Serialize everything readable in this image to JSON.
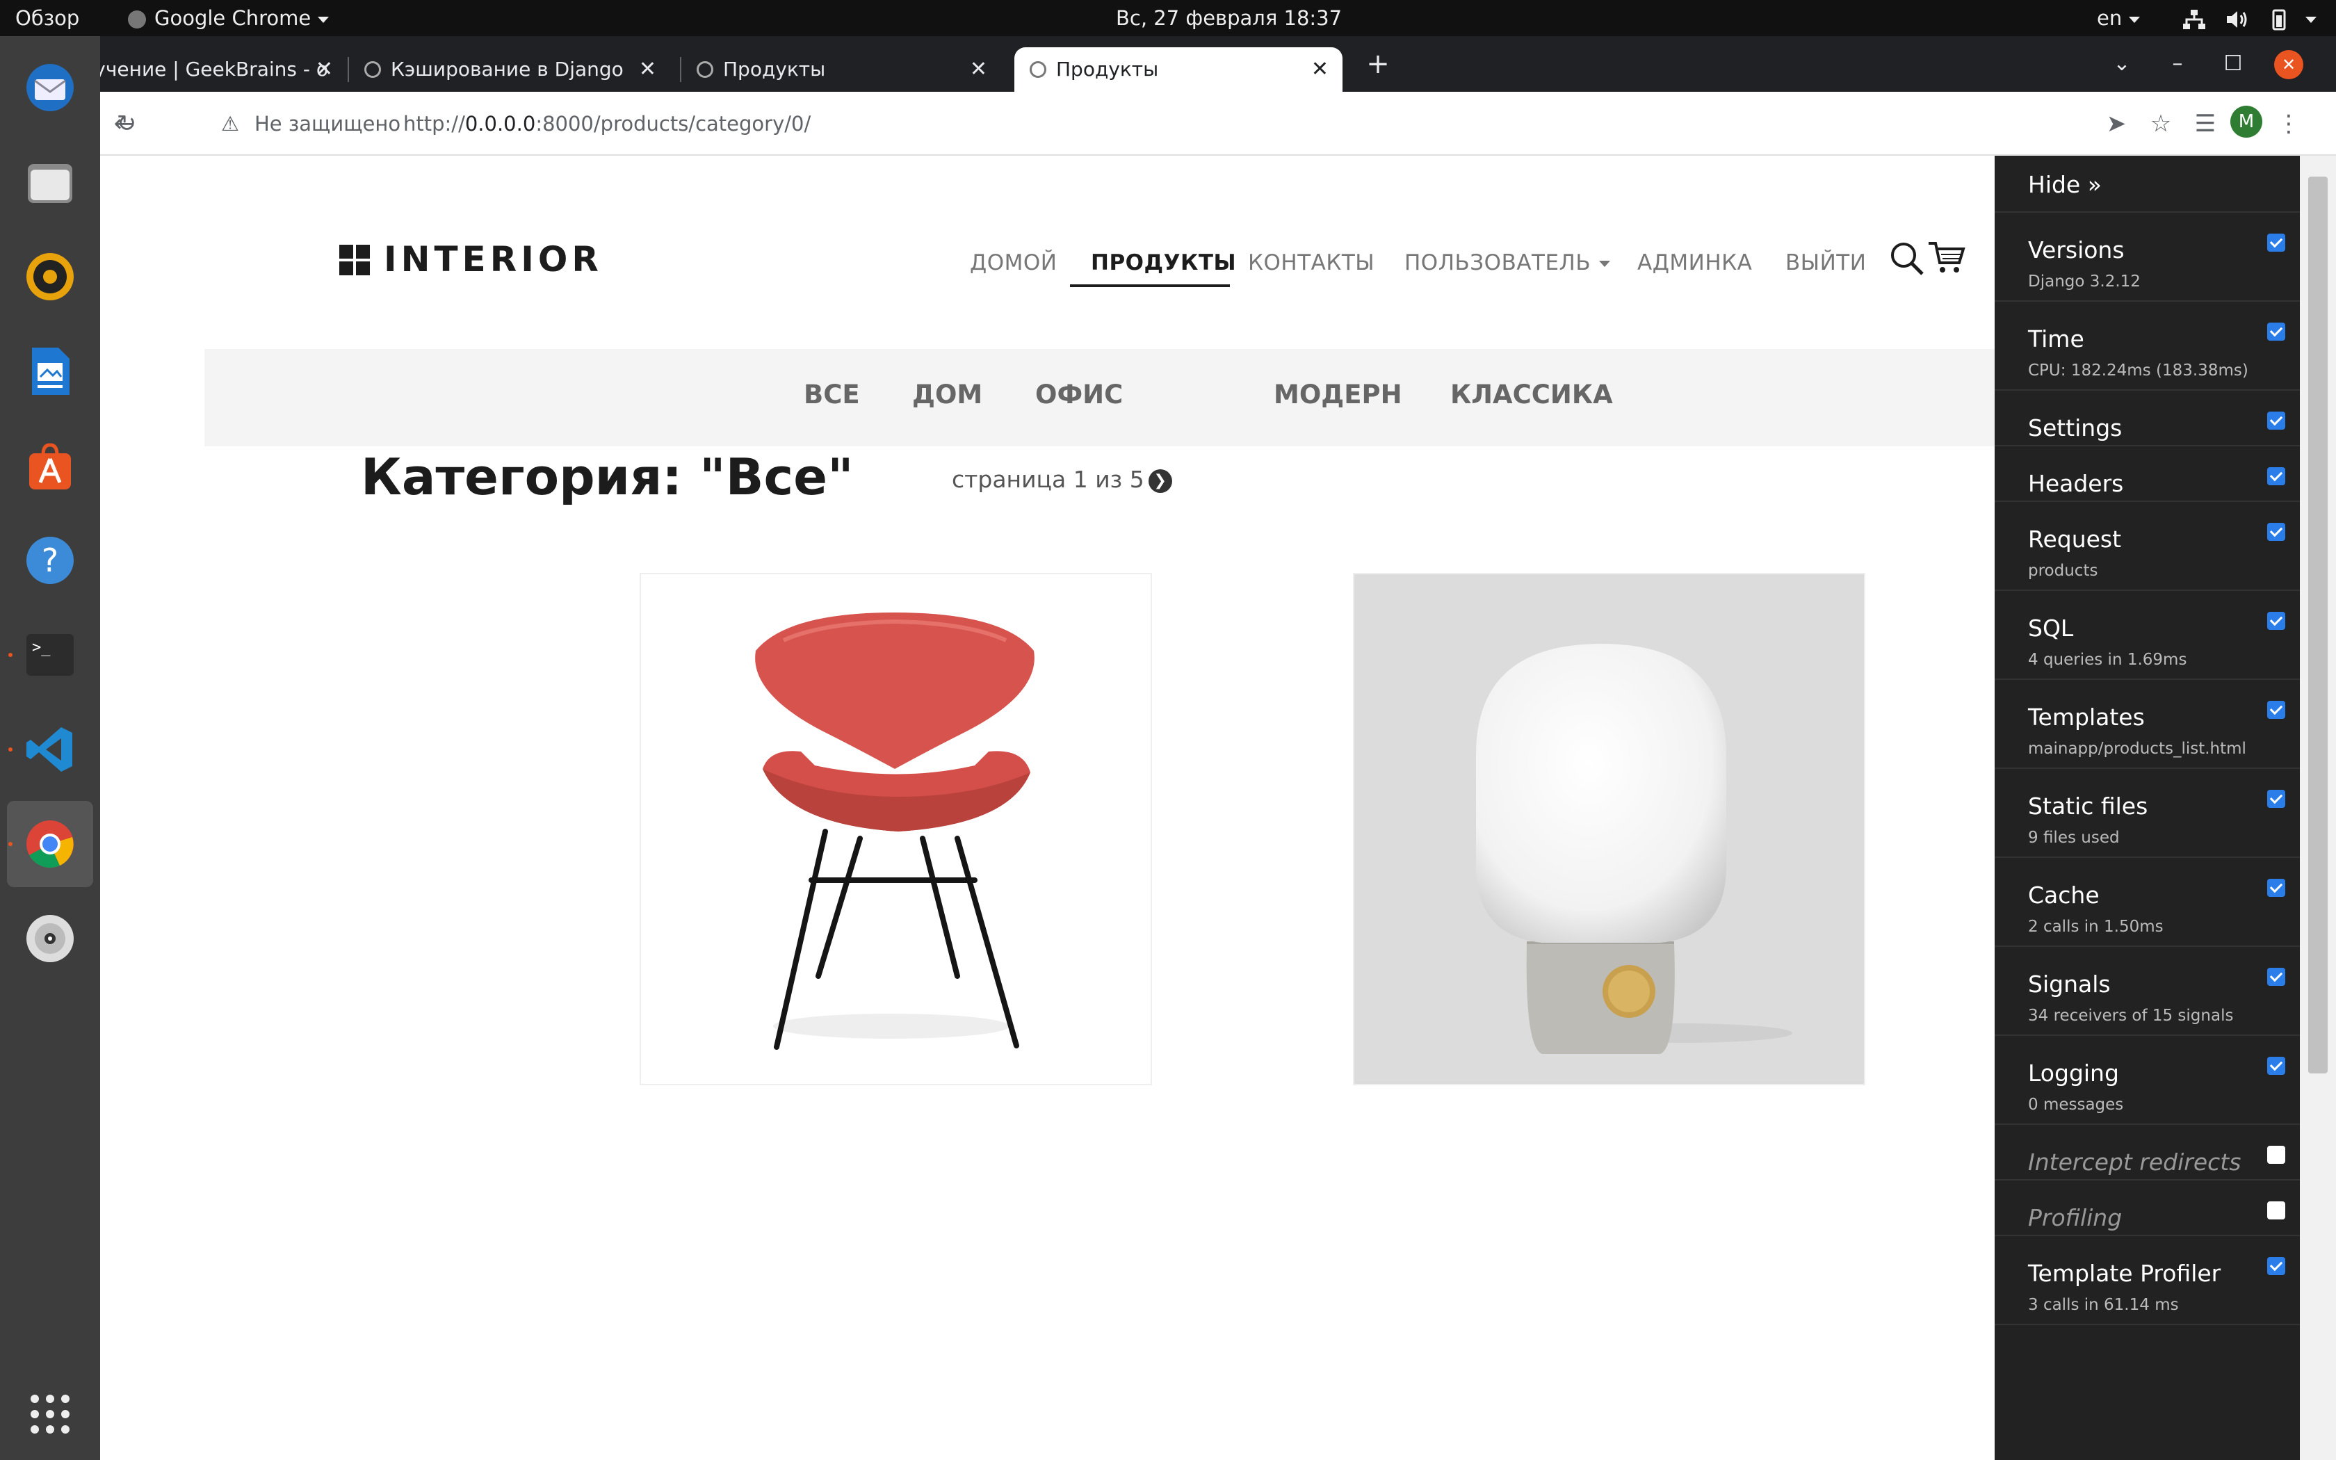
{
  "topbar": {
    "activities": "Обзор",
    "app_name": "Google Chrome",
    "clock": "Вс, 27 февраля  18:37",
    "keyboard_layout": "en"
  },
  "dock": {
    "apps": [
      "thunderbird",
      "files",
      "rhythmbox",
      "writer",
      "software-center",
      "help",
      "terminal",
      "vscode",
      "chrome",
      "dvd"
    ]
  },
  "browser": {
    "tabs": [
      {
        "title": "Обучение | GeekBrains - о"
      },
      {
        "title": "Кэширование в Django"
      },
      {
        "title": "Продукты"
      },
      {
        "title": "Продукты",
        "active": true
      }
    ],
    "new_tab": "+",
    "omnibox": {
      "security_label": "Не защищено",
      "url_host": "0.0.0.0",
      "url_prefix": "http://",
      "url_rest": ":8000/products/category/0/"
    },
    "profile_initial": "M"
  },
  "site": {
    "logo": "INTERIOR",
    "nav": [
      "ДОМОЙ",
      "ПРОДУКТЫ",
      "КОНТАКТЫ",
      "ПОЛЬЗОВАТЕЛЬ",
      "АДМИНКА",
      "ВЫЙТИ"
    ],
    "active_nav": "ПРОДУКТЫ",
    "categories": [
      "ВСЕ",
      "ДОМ",
      "ОФИС",
      "МОДЕРН",
      "КЛАССИКА"
    ],
    "heading": "Категория: \"Все\"",
    "pager": "страница 1 из 5",
    "products": [
      "red-chair",
      "white-lamp"
    ]
  },
  "debug_toolbar": {
    "hide": "Hide »",
    "panels": [
      {
        "title": "Versions",
        "sub": "Django 3.2.12",
        "checked": true
      },
      {
        "title": "Time",
        "sub": "CPU: 182.24ms (183.38ms)",
        "checked": true
      },
      {
        "title": "Settings",
        "sub": "",
        "checked": true
      },
      {
        "title": "Headers",
        "sub": "",
        "checked": true
      },
      {
        "title": "Request",
        "sub": "products",
        "checked": true
      },
      {
        "title": "SQL",
        "sub": "4 queries in 1.69ms",
        "checked": true
      },
      {
        "title": "Templates",
        "sub": "mainapp/products_list.html",
        "checked": true
      },
      {
        "title": "Static files",
        "sub": "9 files used",
        "checked": true
      },
      {
        "title": "Cache",
        "sub": "2 calls in 1.50ms",
        "checked": true
      },
      {
        "title": "Signals",
        "sub": "34 receivers of 15 signals",
        "checked": true
      },
      {
        "title": "Logging",
        "sub": "0 messages",
        "checked": true
      },
      {
        "title": "Intercept redirects",
        "sub": "",
        "checked": false
      },
      {
        "title": "Profiling",
        "sub": "",
        "checked": false
      },
      {
        "title": "Template Profiler",
        "sub": "3 calls in 61.14 ms",
        "checked": true
      }
    ]
  }
}
